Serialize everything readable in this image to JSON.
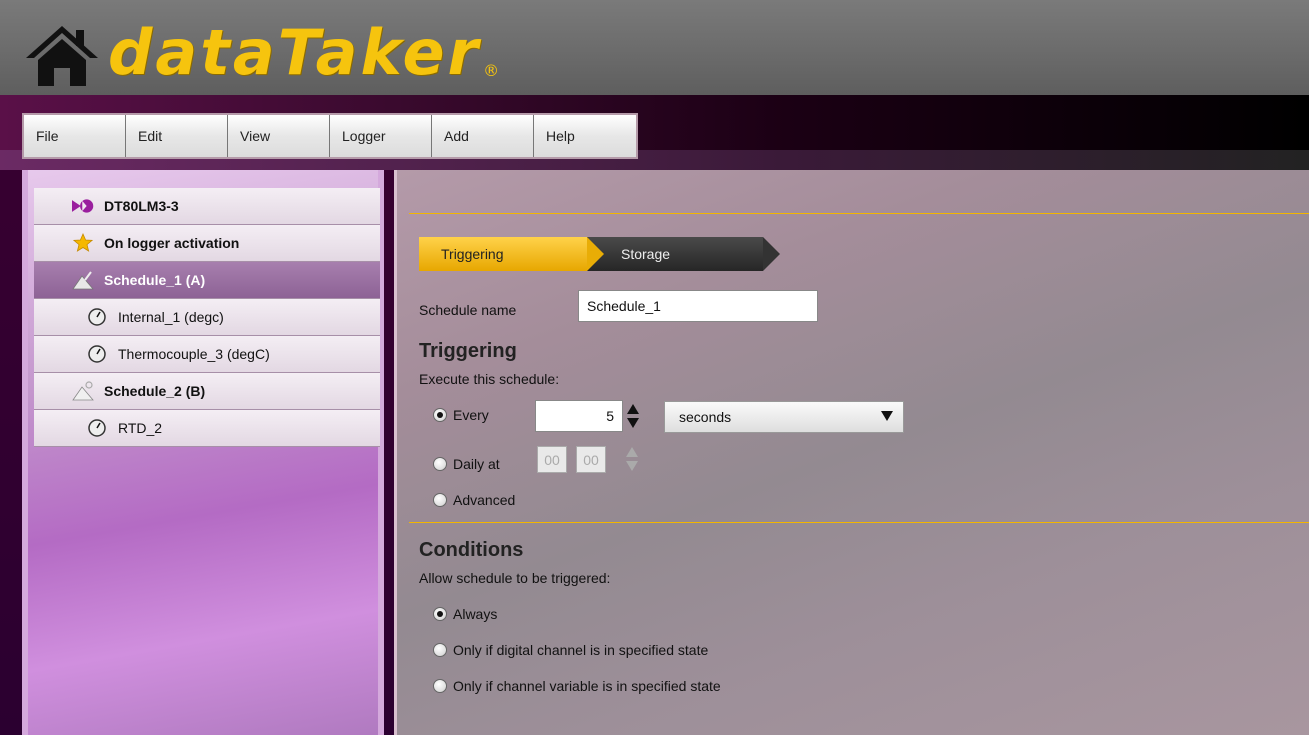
{
  "app": {
    "brand": "dataTaker",
    "reg": "®"
  },
  "menu": [
    "File",
    "Edit",
    "View",
    "Logger",
    "Add",
    "Help"
  ],
  "tree": [
    {
      "label": "DT80LM3-3",
      "icon": "datataker-logo-icon",
      "level": 0,
      "bold": true,
      "selected": false
    },
    {
      "label": "On logger activation",
      "icon": "star-icon",
      "level": 0,
      "bold": true,
      "selected": false
    },
    {
      "label": "Schedule_1 (A)",
      "icon": "schedule-icon",
      "level": 0,
      "bold": true,
      "selected": true
    },
    {
      "label": "Internal_1 (degc)",
      "icon": "gauge-icon",
      "level": 1,
      "bold": false,
      "selected": false
    },
    {
      "label": "Thermocouple_3 (degC)",
      "icon": "gauge-icon",
      "level": 1,
      "bold": false,
      "selected": false
    },
    {
      "label": "Schedule_2 (B)",
      "icon": "schedule-icon",
      "level": 0,
      "bold": true,
      "selected": false
    },
    {
      "label": "RTD_2",
      "icon": "gauge-icon",
      "level": 1,
      "bold": false,
      "selected": false
    }
  ],
  "steps": {
    "active": "Triggering",
    "next": "Storage"
  },
  "form": {
    "schedule_name_label": "Schedule name",
    "schedule_name_value": "Schedule_1",
    "triggering_heading": "Triggering",
    "execute_label": "Execute this schedule:",
    "every_label": "Every",
    "every_value": "5",
    "unit_value": "seconds",
    "daily_label": "Daily at",
    "daily_hh": "00",
    "daily_mm": "00",
    "advanced_label": "Advanced",
    "trigger_selected": "Every",
    "conditions_heading": "Conditions",
    "allow_label": "Allow schedule to be triggered:",
    "cond_always": "Always",
    "cond_digital": "Only if digital channel is in specified state",
    "cond_variable": "Only if channel variable is in specified state",
    "condition_selected": "Always"
  },
  "colors": {
    "accent": "#f2b600",
    "selected_row": "#8d6295",
    "brand": "#f6c40e"
  }
}
